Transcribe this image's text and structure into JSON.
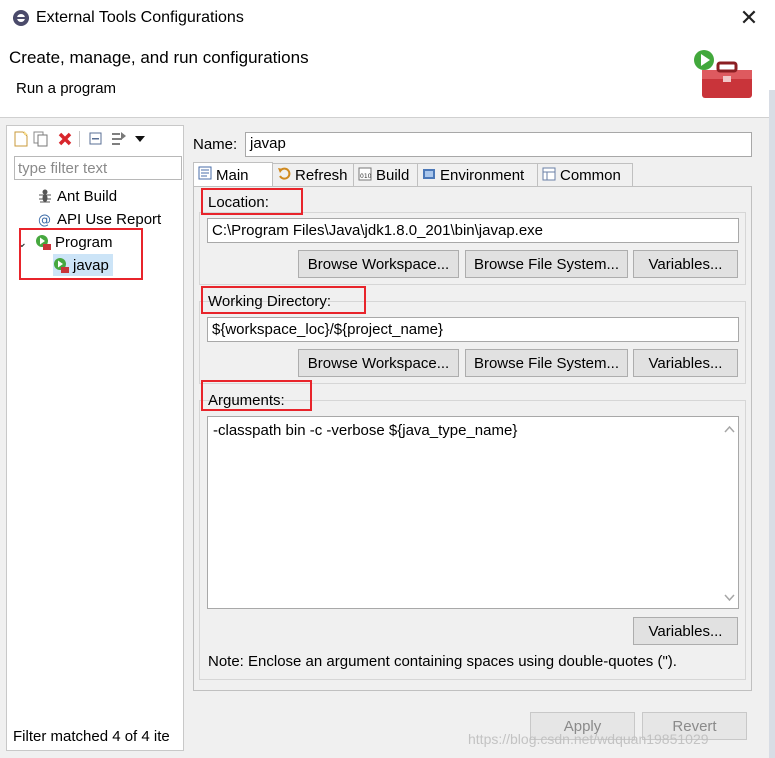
{
  "window": {
    "title": "External Tools Configurations",
    "close_glyph": "✕"
  },
  "header": {
    "title": "Create, manage, and run configurations",
    "subtitle": "Run a program",
    "graphic_icon": "toolbox-run-icon"
  },
  "left_panel": {
    "toolbar": [
      "new-config-icon",
      "duplicate-config-icon",
      "delete-config-icon",
      "collapse-all-icon",
      "filter-icon",
      "view-menu-chevron-icon"
    ],
    "filter_placeholder": "type filter text",
    "tree": [
      {
        "label": "Ant Build",
        "icon": "ant-icon",
        "level": 1
      },
      {
        "label": "API Use Report",
        "icon": "api-report-icon",
        "level": 1
      },
      {
        "label": "Program",
        "icon": "program-run-icon",
        "level": 0,
        "expanded": true,
        "toggle": "⌄"
      },
      {
        "label": "javap",
        "icon": "program-run-icon",
        "level": 2,
        "selected": true
      }
    ],
    "status": "Filter matched 4 of 4 ite"
  },
  "config": {
    "name_label": "Name:",
    "name_value": "javap",
    "tabs": [
      {
        "label": "Main",
        "icon": "main-tab-icon",
        "active": true
      },
      {
        "label": "Refresh",
        "icon": "refresh-icon"
      },
      {
        "label": "Build",
        "icon": "build-icon"
      },
      {
        "label": "Environment",
        "icon": "environment-icon"
      },
      {
        "label": "Common",
        "icon": "common-icon"
      }
    ],
    "location": {
      "label": "Location:",
      "value": "C:\\Program Files\\Java\\jdk1.8.0_201\\bin\\javap.exe",
      "browse_workspace": "Browse Workspace...",
      "browse_fs": "Browse File System...",
      "variables": "Variables..."
    },
    "working_dir": {
      "label": "Working Directory:",
      "value": "${workspace_loc}/${project_name}",
      "browse_workspace": "Browse Workspace...",
      "browse_fs": "Browse File System...",
      "variables": "Variables..."
    },
    "arguments": {
      "label": "Arguments:",
      "value": "-classpath bin -c -verbose ${java_type_name}",
      "variables": "Variables...",
      "note": "Note: Enclose an argument containing spaces using double-quotes (\")."
    },
    "apply_label": "Apply",
    "revert_label": "Revert"
  },
  "watermark": "https://blog.csdn.net/wdquan19851029",
  "colors": {
    "highlight_box": "#e8242b",
    "selection": "#cce4f7",
    "dialog_bg": "#f0f0f0"
  }
}
